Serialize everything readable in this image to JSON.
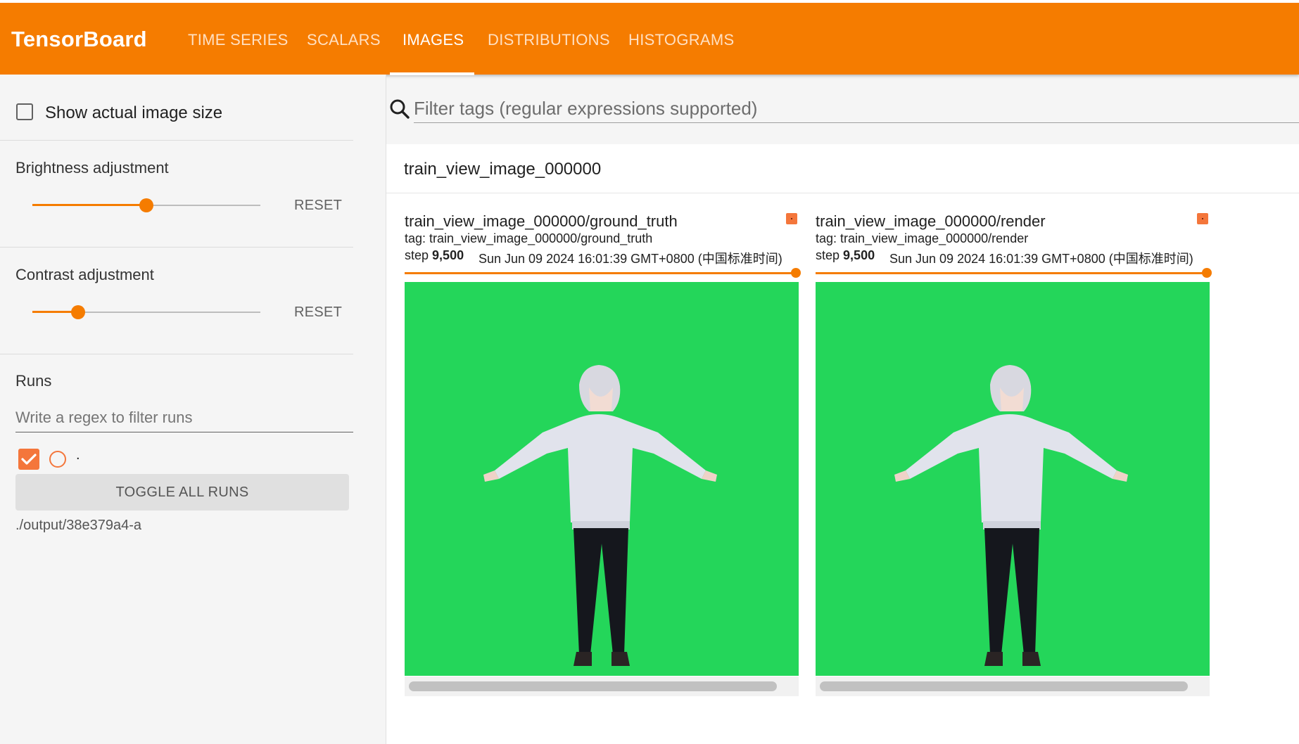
{
  "app": {
    "brand": "TensorBoard"
  },
  "nav": {
    "tabs": [
      {
        "label": "TIME SERIES"
      },
      {
        "label": "SCALARS"
      },
      {
        "label": "IMAGES",
        "active": true
      },
      {
        "label": "DISTRIBUTIONS"
      },
      {
        "label": "HISTOGRAMS"
      }
    ]
  },
  "sidebar": {
    "show_actual_size": {
      "label": "Show actual image size",
      "checked": false
    },
    "brightness": {
      "title": "Brightness adjustment",
      "value": 0.5,
      "reset_label": "RESET"
    },
    "contrast": {
      "title": "Contrast adjustment",
      "value": 0.2,
      "reset_label": "RESET"
    },
    "runs": {
      "title": "Runs",
      "filter_placeholder": "Write a regex to filter runs",
      "run_label": ".",
      "run_checked": true,
      "toggle_all_label": "TOGGLE ALL RUNS",
      "run_path": "./output/38e379a4-a"
    }
  },
  "main": {
    "filter_placeholder": "Filter tags (regular expressions supported)",
    "group_title": "train_view_image_000000",
    "cards": [
      {
        "title": "train_view_image_000000/ground_truth",
        "tag": "tag: train_view_image_000000/ground_truth",
        "step_label": "step",
        "step_value": "9,500",
        "timestamp": "Sun Jun 09 2024 16:01:39 GMT+0800 (中国标准时间)"
      },
      {
        "title": "train_view_image_000000/render",
        "tag": "tag: train_view_image_000000/render",
        "step_label": "step",
        "step_value": "9,500",
        "timestamp": "Sun Jun 09 2024 16:01:39 GMT+0800 (中国标准时间)"
      }
    ]
  },
  "colors": {
    "accent": "#f57c00",
    "run_color": "#f4763b",
    "image_background": "#24d65a"
  }
}
